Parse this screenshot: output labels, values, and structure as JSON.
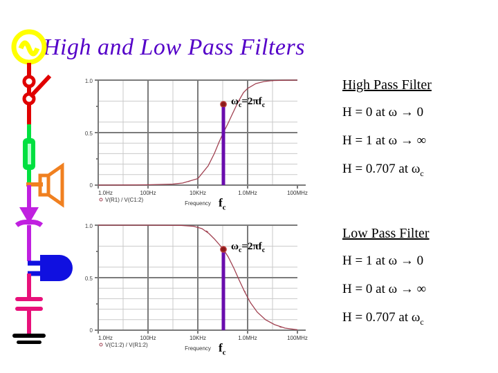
{
  "slide": {
    "title": "High and Low Pass Filters",
    "title_color": "#5400c8",
    "background": "#ffffff"
  },
  "circuit_art": {
    "name": "electric-circuit-clipart",
    "components": [
      {
        "name": "ac-source-icon",
        "color": "#ffff00"
      },
      {
        "name": "switch-icon",
        "color": "#e00000"
      },
      {
        "name": "resistor-icon",
        "color": "#00e040"
      },
      {
        "name": "speaker-icon",
        "color": "#f08020"
      },
      {
        "name": "diode-icon",
        "color": "#c020e0"
      },
      {
        "name": "lamp-icon",
        "color": "#1010e0"
      },
      {
        "name": "capacitor-icon",
        "color": "#e8107a"
      },
      {
        "name": "ground-icon",
        "color": "#000000"
      }
    ]
  },
  "charts": [
    {
      "id": "highpass",
      "annotation_omega": "ω",
      "annotation_omega_sub": "c",
      "annotation_omega_rest": "=2πf",
      "annotation_omega_rest_sub": "c",
      "annotation_fc": "f",
      "annotation_fc_sub": "c"
    },
    {
      "id": "lowpass",
      "annotation_omega": "ω",
      "annotation_omega_sub": "c",
      "annotation_omega_rest": "=2πf",
      "annotation_omega_rest_sub": "c",
      "annotation_fc": "f",
      "annotation_fc_sub": "c"
    }
  ],
  "chart_data": [
    {
      "type": "line",
      "id": "highpass",
      "title": "",
      "xlabel": "Frequency",
      "ylabel": "",
      "legend": [
        "V(R1) / V(C1:2)"
      ],
      "legend_position": "below-left",
      "grid": true,
      "x_scale": "log",
      "xticklabels": [
        "1.0Hz",
        "100Hz",
        "10KHz",
        "1.0MHz",
        "100MHz"
      ],
      "xtickvalues": [
        1,
        100,
        10000,
        1000000,
        100000000
      ],
      "yticklabels": [
        "0",
        "0.5",
        "1.0"
      ],
      "ylim": [
        0,
        1.0
      ],
      "xlim": [
        1,
        100000000
      ],
      "series": [
        {
          "name": "V(R1) / V(C1:2)",
          "color": "#a04050",
          "x": [
            1,
            10,
            100,
            1000,
            3000,
            10000,
            30000,
            60000,
            100000,
            159000,
            250000,
            400000,
            700000,
            1000000,
            3000000,
            10000000,
            100000000
          ],
          "values": [
            1e-05,
            0.0001,
            0.001,
            0.0063,
            0.019,
            0.062,
            0.185,
            0.35,
            0.53,
            0.707,
            0.84,
            0.93,
            0.975,
            0.987,
            0.998,
            1.0,
            1.0
          ]
        }
      ],
      "marker": {
        "x": 159000,
        "y": 0.707,
        "label": "ωc=2πfc",
        "color": "#8b1a1a"
      },
      "cutoff_line": {
        "x": 159000,
        "y_from": 0,
        "y_to": 0.707,
        "color": "#6a0dad",
        "label": "fc"
      }
    },
    {
      "type": "line",
      "id": "lowpass",
      "title": "",
      "xlabel": "Frequency",
      "ylabel": "",
      "legend": [
        "V(C1:2) / V(R1:2)"
      ],
      "legend_position": "below-left",
      "grid": true,
      "x_scale": "log",
      "xticklabels": [
        "1.0Hz",
        "100Hz",
        "10KHz",
        "1.0MHz",
        "100MHz"
      ],
      "xtickvalues": [
        1,
        100,
        10000,
        1000000,
        100000000
      ],
      "yticklabels": [
        "0",
        "0.5",
        "1.0"
      ],
      "ylim": [
        0,
        1.0
      ],
      "xlim": [
        1,
        100000000
      ],
      "series": [
        {
          "name": "V(C1:2) / V(R1:2)",
          "color": "#a04050",
          "x": [
            1,
            100,
            10000,
            30000,
            60000,
            100000,
            159000,
            250000,
            400000,
            700000,
            1000000,
            2000000,
            5000000,
            10000000,
            30000000,
            100000000
          ],
          "values": [
            1.0,
            1.0,
            0.998,
            0.983,
            0.937,
            0.846,
            0.707,
            0.537,
            0.369,
            0.222,
            0.157,
            0.079,
            0.032,
            0.016,
            0.005,
            0.0016
          ]
        }
      ],
      "marker": {
        "x": 159000,
        "y": 0.707,
        "label": "ωc=2πfc",
        "color": "#8b1a1a"
      },
      "cutoff_line": {
        "x": 159000,
        "y_from": 0,
        "y_to": 0.707,
        "color": "#6a0dad",
        "label": "fc"
      }
    }
  ],
  "highpass": {
    "heading": "High Pass Filter",
    "lines": [
      {
        "pre": "H = 0 at ω → 0",
        "sub": ""
      },
      {
        "pre": "H = 1 at ω → ∞",
        "sub": ""
      },
      {
        "pre": "H = 0.707 at ω",
        "sub": "c"
      }
    ]
  },
  "lowpass": {
    "heading": "Low Pass Filter",
    "lines": [
      {
        "pre": "H = 1 at ω → 0",
        "sub": ""
      },
      {
        "pre": "H = 0 at ω → ∞",
        "sub": ""
      },
      {
        "pre": "H = 0.707 at ω",
        "sub": "c"
      }
    ]
  }
}
